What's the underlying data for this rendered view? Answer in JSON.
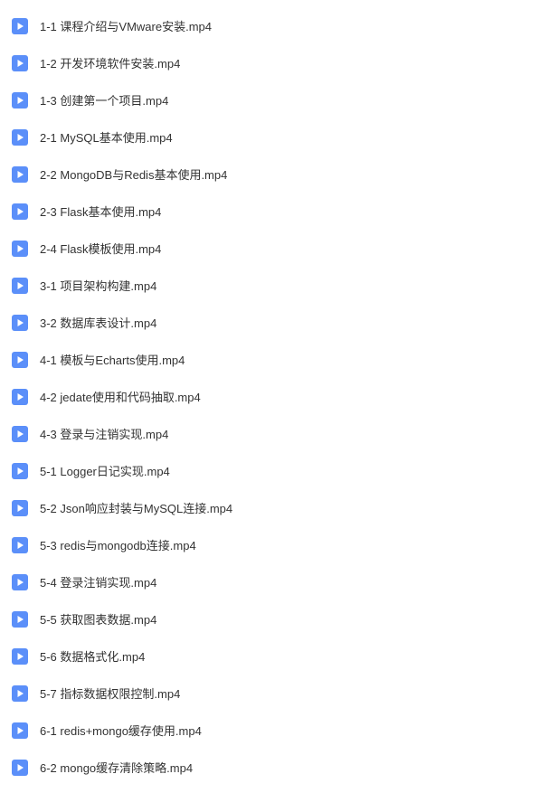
{
  "files": [
    {
      "name": "1-1 课程介绍与VMware安装.mp4"
    },
    {
      "name": "1-2 开发环境软件安装.mp4"
    },
    {
      "name": "1-3 创建第一个项目.mp4"
    },
    {
      "name": "2-1 MySQL基本使用.mp4"
    },
    {
      "name": "2-2 MongoDB与Redis基本使用.mp4"
    },
    {
      "name": "2-3 Flask基本使用.mp4"
    },
    {
      "name": "2-4 Flask模板使用.mp4"
    },
    {
      "name": "3-1 项目架构构建.mp4"
    },
    {
      "name": "3-2 数据库表设计.mp4"
    },
    {
      "name": "4-1 模板与Echarts使用.mp4"
    },
    {
      "name": "4-2 jedate使用和代码抽取.mp4"
    },
    {
      "name": "4-3 登录与注销实现.mp4"
    },
    {
      "name": "5-1 Logger日记实现.mp4"
    },
    {
      "name": "5-2 Json响应封装与MySQL连接.mp4"
    },
    {
      "name": "5-3 redis与mongodb连接.mp4"
    },
    {
      "name": "5-4 登录注销实现.mp4"
    },
    {
      "name": "5-5 获取图表数据.mp4"
    },
    {
      "name": "5-6 数据格式化.mp4"
    },
    {
      "name": "5-7 指标数据权限控制.mp4"
    },
    {
      "name": "6-1 redis+mongo缓存使用.mp4"
    },
    {
      "name": "6-2 mongo缓存清除策略.mp4"
    }
  ],
  "icon": {
    "bg": "#5b8ff9",
    "tri": "#ffffff"
  }
}
